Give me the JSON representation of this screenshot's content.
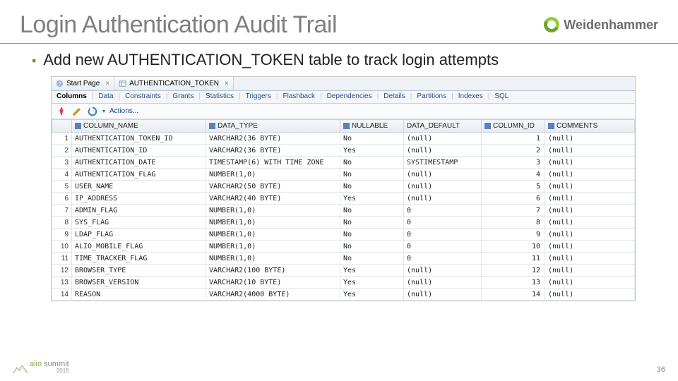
{
  "slide": {
    "title": "Login Authentication Audit Trail",
    "brand": "Weidenhammer",
    "bullet": "Add new AUTHENTICATION_TOKEN table to track login attempts",
    "page_number": "36",
    "footer_logo_text": "alio summit",
    "footer_year": "2019"
  },
  "doc_tabs": [
    {
      "label": "Start Page"
    },
    {
      "label": "AUTHENTICATION_TOKEN"
    }
  ],
  "view_tabs": [
    "Columns",
    "Data",
    "Constraints",
    "Grants",
    "Statistics",
    "Triggers",
    "Flashback",
    "Dependencies",
    "Details",
    "Partitions",
    "Indexes",
    "SQL"
  ],
  "active_view_tab": "Columns",
  "toolbar": {
    "actions_label": "Actions..."
  },
  "columns": [
    {
      "key": "name",
      "label": "COLUMN_NAME"
    },
    {
      "key": "type",
      "label": "DATA_TYPE"
    },
    {
      "key": "nullable",
      "label": "NULLABLE"
    },
    {
      "key": "default",
      "label": "DATA_DEFAULT"
    },
    {
      "key": "id",
      "label": "COLUMN_ID"
    },
    {
      "key": "comments",
      "label": "COMMENTS"
    }
  ],
  "rows": [
    {
      "n": "1",
      "name": "AUTHENTICATION_TOKEN_ID",
      "type": "VARCHAR2(36 BYTE)",
      "nullable": "No",
      "default": "(null)",
      "id": "1",
      "comments": "(null)"
    },
    {
      "n": "2",
      "name": "AUTHENTICATION_ID",
      "type": "VARCHAR2(36 BYTE)",
      "nullable": "Yes",
      "default": "(null)",
      "id": "2",
      "comments": "(null)"
    },
    {
      "n": "3",
      "name": "AUTHENTICATION_DATE",
      "type": "TIMESTAMP(6) WITH TIME ZONE",
      "nullable": "No",
      "default": "SYSTIMESTAMP",
      "id": "3",
      "comments": "(null)"
    },
    {
      "n": "4",
      "name": "AUTHENTICATION_FLAG",
      "type": "NUMBER(1,0)",
      "nullable": "No",
      "default": "(null)",
      "id": "4",
      "comments": "(null)"
    },
    {
      "n": "5",
      "name": "USER_NAME",
      "type": "VARCHAR2(50 BYTE)",
      "nullable": "No",
      "default": "(null)",
      "id": "5",
      "comments": "(null)"
    },
    {
      "n": "6",
      "name": "IP_ADDRESS",
      "type": "VARCHAR2(40 BYTE)",
      "nullable": "Yes",
      "default": "(null)",
      "id": "6",
      "comments": "(null)"
    },
    {
      "n": "7",
      "name": "ADMIN_FLAG",
      "type": "NUMBER(1,0)",
      "nullable": "No",
      "default": "0",
      "id": "7",
      "comments": "(null)"
    },
    {
      "n": "8",
      "name": "SYS_FLAG",
      "type": "NUMBER(1,0)",
      "nullable": "No",
      "default": "0",
      "id": "8",
      "comments": "(null)"
    },
    {
      "n": "9",
      "name": "LDAP_FLAG",
      "type": "NUMBER(1,0)",
      "nullable": "No",
      "default": "0",
      "id": "9",
      "comments": "(null)"
    },
    {
      "n": "10",
      "name": "ALIO_MOBILE_FLAG",
      "type": "NUMBER(1,0)",
      "nullable": "No",
      "default": "0",
      "id": "10",
      "comments": "(null)"
    },
    {
      "n": "11",
      "name": "TIME_TRACKER_FLAG",
      "type": "NUMBER(1,0)",
      "nullable": "No",
      "default": "0",
      "id": "11",
      "comments": "(null)"
    },
    {
      "n": "12",
      "name": "BROWSER_TYPE",
      "type": "VARCHAR2(100 BYTE)",
      "nullable": "Yes",
      "default": "(null)",
      "id": "12",
      "comments": "(null)"
    },
    {
      "n": "13",
      "name": "BROWSER_VERSION",
      "type": "VARCHAR2(10 BYTE)",
      "nullable": "Yes",
      "default": "(null)",
      "id": "13",
      "comments": "(null)"
    },
    {
      "n": "14",
      "name": "REASON",
      "type": "VARCHAR2(4000 BYTE)",
      "nullable": "Yes",
      "default": "(null)",
      "id": "14",
      "comments": "(null)"
    }
  ]
}
